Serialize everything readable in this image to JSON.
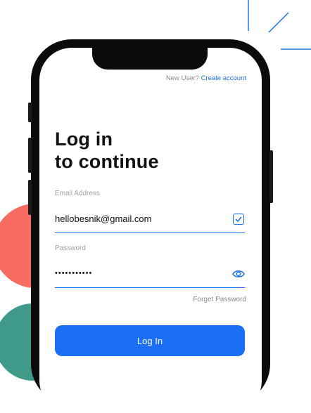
{
  "header": {
    "new_user_text": "New User?",
    "create_account_link": "Create account"
  },
  "heading": {
    "line1": "Log in",
    "line2": "to continue"
  },
  "email": {
    "label": "Email Address",
    "value": "hellobesnik@gmail.com",
    "status_icon": "checkbox-checked-icon"
  },
  "password": {
    "label": "Password",
    "value": "•••••••••••",
    "toggle_icon": "eye-icon"
  },
  "forgot_password_link": "Forget Password",
  "login_button_label": "Log In",
  "colors": {
    "accent": "#1a6ff4",
    "link": "#1a73e8",
    "decor_red": "#fa6c61",
    "decor_green": "#3f9a8a"
  }
}
